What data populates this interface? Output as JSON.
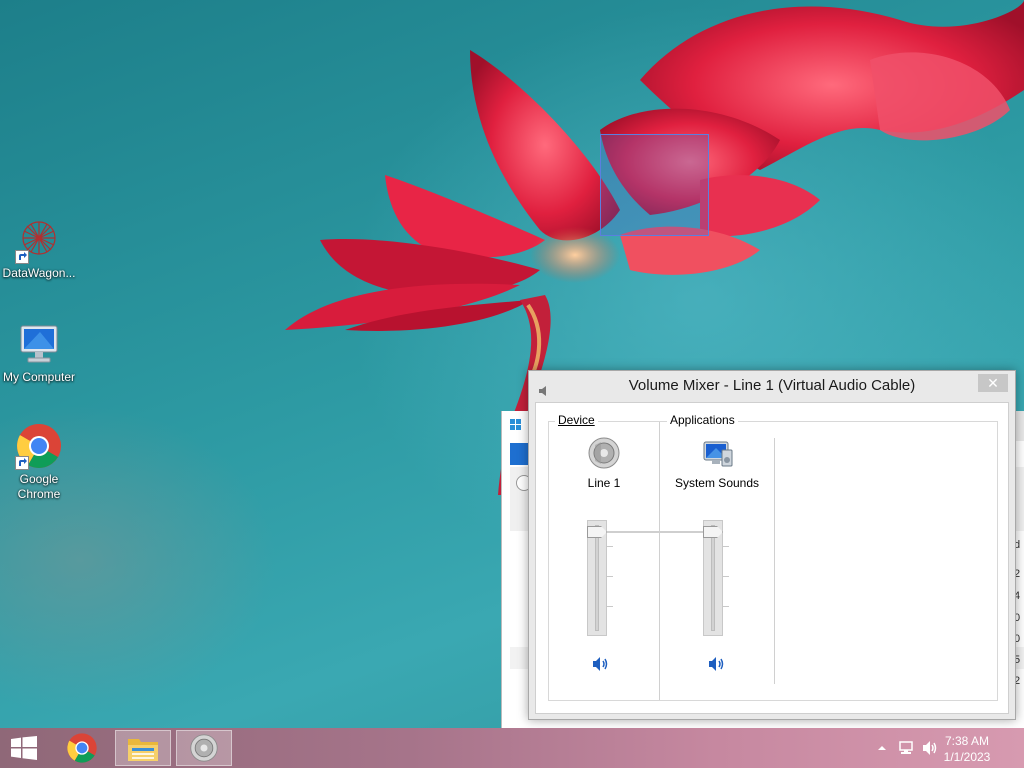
{
  "desktop": {
    "icons": [
      {
        "label": "DataWagon...",
        "icon": "datawagon-icon"
      },
      {
        "label": "My Computer",
        "icon": "computer-icon"
      },
      {
        "label_line1": "Google",
        "label_line2": "Chrome",
        "icon": "chrome-icon"
      }
    ]
  },
  "mixer": {
    "title": "Volume Mixer - Line 1 (Virtual Audio Cable)",
    "close_label": "✕",
    "device_group": "Device",
    "applications_group": "Applications",
    "channels": [
      {
        "name": "Line 1",
        "icon": "speaker-icon",
        "level": 1.0,
        "muted": false
      },
      {
        "name": "System Sounds",
        "icon": "system-sounds-icon",
        "level": 1.0,
        "muted": false
      }
    ]
  },
  "background_window": {
    "edge_chars": [
      "d",
      "2",
      "4",
      "0",
      "0",
      "5",
      "2"
    ]
  },
  "taskbar": {
    "buttons": [
      {
        "name": "start-button",
        "icon": "windows-logo-icon"
      },
      {
        "name": "chrome-taskbar-button",
        "icon": "chrome-icon"
      },
      {
        "name": "file-explorer-taskbar-button",
        "icon": "folder-icon"
      },
      {
        "name": "volume-mixer-taskbar-button",
        "icon": "speaker-icon",
        "active": true
      }
    ],
    "tray": {
      "icons": [
        "show-hidden-icons-icon",
        "network-icon",
        "volume-icon"
      ]
    },
    "clock": {
      "time": "7:38 AM",
      "date": "1/1/2023"
    }
  },
  "colors": {
    "accent": "#1e6fd0",
    "taskbar_start": "#8f6878",
    "taskbar_end": "#d79ab0",
    "wallpaper": "#2b8f96",
    "flower": "#e0203f"
  }
}
